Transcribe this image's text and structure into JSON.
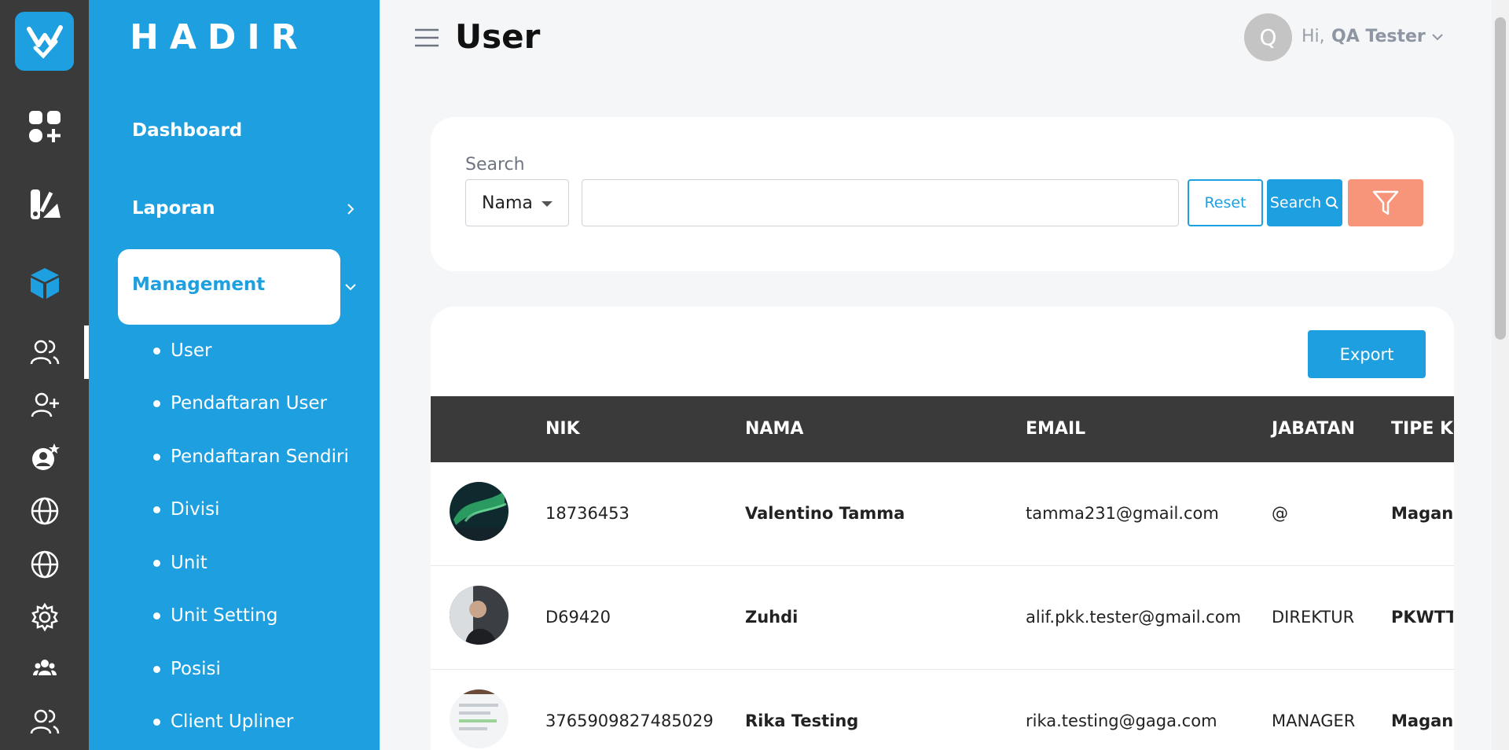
{
  "app": {
    "brand": "HADIR"
  },
  "rail": {
    "icons": [
      "app-logo-icon",
      "dashboard-apps-icon",
      "report-icon",
      "management-cube-icon",
      "users-icon",
      "add-user-icon",
      "user-star-icon",
      "globe-icon",
      "globe-icon-2",
      "settings-gear-icon",
      "team-icon",
      "users-group-icon"
    ]
  },
  "sidebar": {
    "items": [
      {
        "label": "Dashboard"
      },
      {
        "label": "Laporan"
      },
      {
        "label": "Management"
      }
    ],
    "sub_items": [
      {
        "label": "User"
      },
      {
        "label": "Pendaftaran User"
      },
      {
        "label": "Pendaftaran Sendiri"
      },
      {
        "label": "Divisi"
      },
      {
        "label": "Unit"
      },
      {
        "label": "Unit Setting"
      },
      {
        "label": "Posisi"
      },
      {
        "label": "Client Upliner"
      }
    ]
  },
  "header": {
    "title": "User",
    "avatar_initial": "Q",
    "greeting": "Hi,",
    "user_name": "QA Tester"
  },
  "search": {
    "label": "Search",
    "field_select": "Nama",
    "value": "",
    "reset_label": "Reset",
    "search_label": "Search"
  },
  "table": {
    "export_label": "Export",
    "columns": [
      "NIK",
      "NAMA",
      "EMAIL",
      "JABATAN",
      "TIPE KA"
    ],
    "rows": [
      {
        "nik": "18736453",
        "nama": "Valentino Tamma",
        "email": "tamma231@gmail.com",
        "jabatan": "@",
        "tipe": "Magang"
      },
      {
        "nik": "D69420",
        "nama": "Zuhdi",
        "email": "alif.pkk.tester@gmail.com",
        "jabatan": "DIREKTUR",
        "tipe": "PKWTT"
      },
      {
        "nik": "3765909827485029",
        "nama": "Rika Testing",
        "email": "rika.testing@gaga.com",
        "jabatan": "MANAGER",
        "tipe": "Magang"
      }
    ]
  },
  "colors": {
    "primary": "#1e9fe0",
    "rail": "#3a3a3a",
    "filter": "#f7957a",
    "table_header": "#3a3a3a"
  }
}
